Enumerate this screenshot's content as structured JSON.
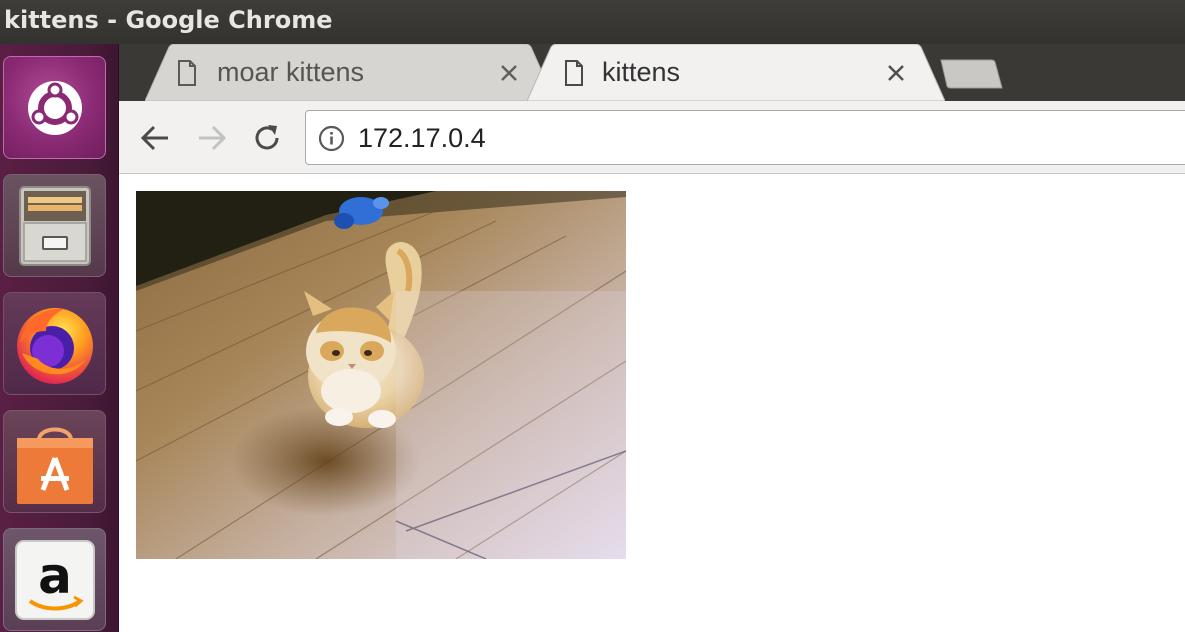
{
  "window": {
    "title": "kittens - Google Chrome"
  },
  "launcher": {
    "items": [
      {
        "name": "Search your computer",
        "icon": "ubuntu-logo-icon"
      },
      {
        "name": "Files",
        "icon": "file-cabinet-icon"
      },
      {
        "name": "Firefox Web Browser",
        "icon": "firefox-icon"
      },
      {
        "name": "Ubuntu Software",
        "icon": "shopping-bag-icon"
      },
      {
        "name": "Amazon",
        "icon": "amazon-icon"
      }
    ]
  },
  "tabs": [
    {
      "title": "moar kittens",
      "active": false,
      "icon": "page-icon"
    },
    {
      "title": "kittens",
      "active": true,
      "icon": "page-icon"
    }
  ],
  "toolbar": {
    "url": "172.17.0.4",
    "back_icon": "arrow-left-icon",
    "forward_icon": "arrow-right-icon",
    "reload_icon": "reload-icon",
    "info_icon": "info-icon"
  },
  "page": {
    "image_subject": "kitten photo"
  },
  "colors": {
    "launcher_bg": "#4a1c3b",
    "titlebar_bg": "#3a3935",
    "tab_active_bg": "#f2f1f0",
    "tab_inactive_bg": "#d6d5d2"
  }
}
